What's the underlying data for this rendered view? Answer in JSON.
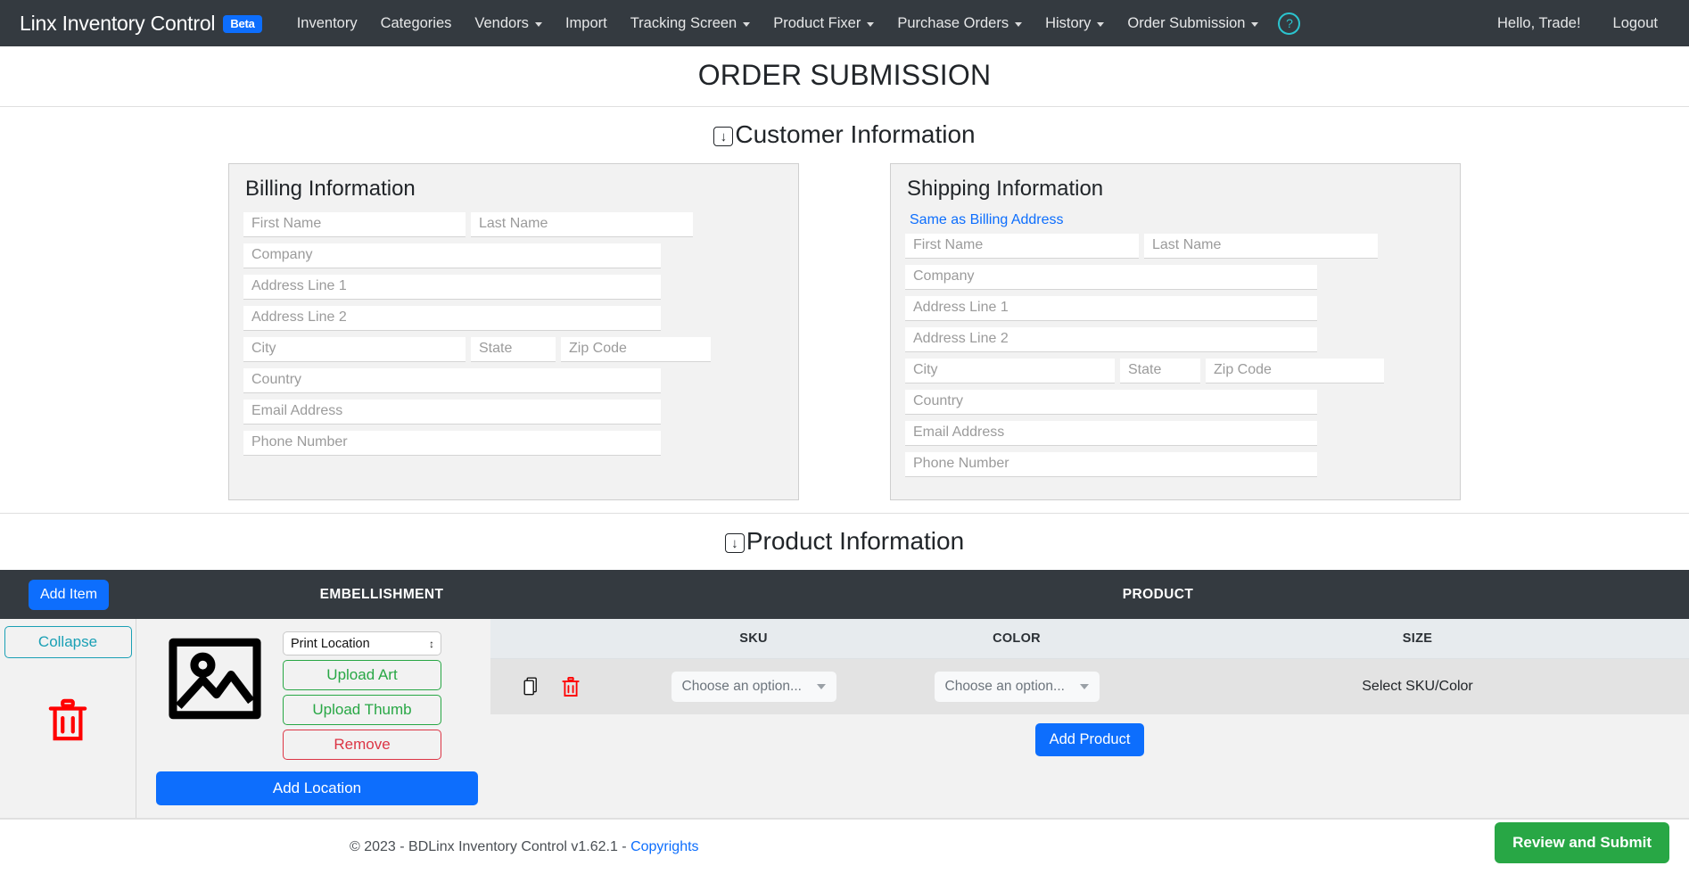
{
  "navbar": {
    "brand": "Linx Inventory Control",
    "beta": "Beta",
    "items": [
      {
        "label": "Inventory",
        "caret": false
      },
      {
        "label": "Categories",
        "caret": false
      },
      {
        "label": "Vendors",
        "caret": true
      },
      {
        "label": "Import",
        "caret": false
      },
      {
        "label": "Tracking Screen",
        "caret": true
      },
      {
        "label": "Product Fixer",
        "caret": true
      },
      {
        "label": "Purchase Orders",
        "caret": true
      },
      {
        "label": "History",
        "caret": true
      },
      {
        "label": "Order Submission",
        "caret": true
      }
    ],
    "help_icon": "question-mark-circle-icon",
    "help_glyph": "?",
    "greeting": "Hello, Trade!",
    "logout": "Logout",
    "background": "#343a40",
    "accent": "#0d6efd",
    "help_color": "#2bc4cf"
  },
  "page": {
    "title": "ORDER SUBMISSION"
  },
  "customer_section": {
    "heading": "Customer Information",
    "arrow_glyph": "↓",
    "billing": {
      "title": "Billing Information",
      "fields": {
        "first_name": "First Name",
        "last_name": "Last Name",
        "company": "Company",
        "address1": "Address Line 1",
        "address2": "Address Line 2",
        "city": "City",
        "state": "State",
        "zip": "Zip Code",
        "country": "Country",
        "email": "Email Address",
        "phone": "Phone Number"
      },
      "values": {
        "first_name": "",
        "last_name": "",
        "company": "",
        "address1": "",
        "address2": "",
        "city": "",
        "state": "",
        "zip": "",
        "country": "",
        "email": "",
        "phone": ""
      }
    },
    "shipping": {
      "title": "Shipping Information",
      "same_as_billing": "Same as Billing Address",
      "fields": {
        "first_name": "First Name",
        "last_name": "Last Name",
        "company": "Company",
        "address1": "Address Line 1",
        "address2": "Address Line 2",
        "city": "City",
        "state": "State",
        "zip": "Zip Code",
        "country": "Country",
        "email": "Email Address",
        "phone": "Phone Number"
      },
      "values": {
        "first_name": "",
        "last_name": "",
        "company": "",
        "address1": "",
        "address2": "",
        "city": "",
        "state": "",
        "zip": "",
        "country": "",
        "email": "",
        "phone": ""
      }
    }
  },
  "product_section": {
    "heading": "Product Information",
    "arrow_glyph": "↓",
    "header": {
      "add_item": "Add Item",
      "embellishment": "EMBELLISHMENT",
      "product": "PRODUCT"
    },
    "item": {
      "collapse": "Collapse",
      "delete_icon": "trash-icon",
      "image_placeholder_icon": "image-placeholder-icon",
      "print_location": "Print Location",
      "print_location_options": [
        "Print Location"
      ],
      "upload_art": "Upload Art",
      "upload_thumb": "Upload Thumb",
      "remove": "Remove",
      "add_location": "Add Location"
    },
    "table": {
      "columns": [
        "",
        "SKU",
        "COLOR",
        "SIZE"
      ],
      "rows": [
        {
          "copy_icon": "copy-icon",
          "delete_icon": "trash-icon",
          "sku": "Choose an option...",
          "color": "Choose an option...",
          "size": "Select SKU/Color"
        }
      ],
      "add_product": "Add Product"
    }
  },
  "footer": {
    "copyright": "© 2023 - BDLinx Inventory Control v1.62.1 - ",
    "copyright_link": "Copyrights",
    "submit": "Review and Submit",
    "submit_color": "#28a745"
  }
}
